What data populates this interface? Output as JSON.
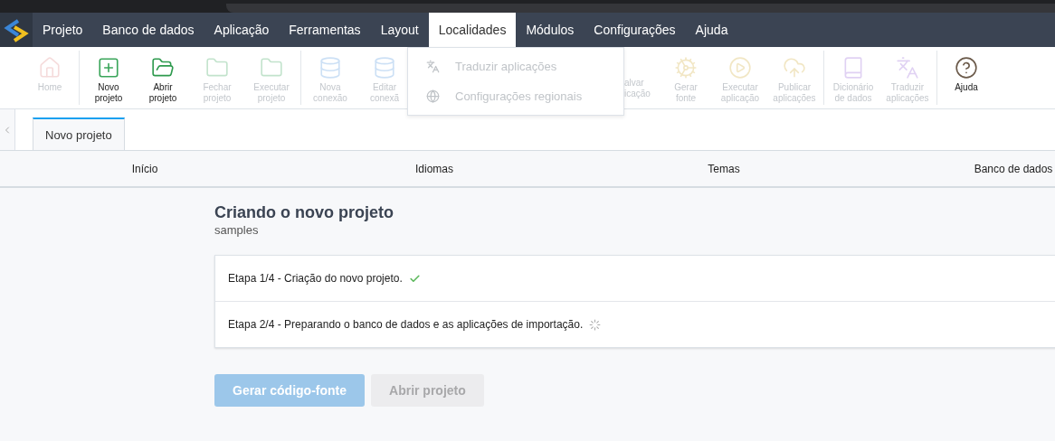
{
  "menu_bar": {
    "items": [
      {
        "label": "Projeto",
        "selected": false
      },
      {
        "label": "Banco de dados",
        "selected": false
      },
      {
        "label": "Aplicação",
        "selected": false
      },
      {
        "label": "Ferramentas",
        "selected": false
      },
      {
        "label": "Layout",
        "selected": false
      },
      {
        "label": "Localidades",
        "selected": true
      },
      {
        "label": "Módulos",
        "selected": false
      },
      {
        "label": "Configurações",
        "selected": false
      },
      {
        "label": "Ajuda",
        "selected": false
      }
    ]
  },
  "toolbar": {
    "groups": [
      [
        {
          "lines": [
            "Home"
          ],
          "disabled": true
        }
      ],
      [
        {
          "lines": [
            "Novo",
            "projeto"
          ],
          "disabled": false
        },
        {
          "lines": [
            "Abrir",
            "projeto"
          ],
          "disabled": false
        },
        {
          "lines": [
            "Fechar",
            "projeto"
          ],
          "disabled": true
        },
        {
          "lines": [
            "Executar",
            "projeto"
          ],
          "disabled": true
        }
      ],
      [
        {
          "lines": [
            "Nova",
            "conexão"
          ],
          "disabled": true
        },
        {
          "lines": [
            "Editar",
            "conexã"
          ],
          "disabled": true
        },
        {
          "kind": "partial",
          "lines": [
            "alvar",
            "icação"
          ],
          "disabled": true
        },
        {
          "lines": [
            "Gerar",
            "fonte"
          ],
          "disabled": true
        },
        {
          "lines": [
            "Executar",
            "aplicação"
          ],
          "disabled": true
        },
        {
          "lines": [
            "Publicar",
            "aplicações"
          ],
          "disabled": true
        }
      ],
      [
        {
          "lines": [
            "Dicionário",
            "de dados"
          ],
          "disabled": true
        },
        {
          "lines": [
            "Traduzir",
            "aplicações"
          ],
          "disabled": true
        }
      ],
      [
        {
          "lines": [
            "Ajuda"
          ],
          "disabled": false
        }
      ]
    ]
  },
  "dropdown": {
    "items": [
      {
        "label": "Traduzir aplicações",
        "disabled": true
      },
      {
        "label": "Configurações regionais",
        "disabled": true
      }
    ]
  },
  "tabs": [
    {
      "label": "Novo projeto",
      "selected": true
    }
  ],
  "wizard_steps": [
    "Início",
    "Idiomas",
    "Temas",
    "Banco de dados"
  ],
  "title": "Criando o novo projeto",
  "subtitle": "samples",
  "progress": [
    {
      "label": "Etapa 1/4 - Criação do novo projeto.",
      "done": true
    },
    {
      "label": "Etapa 2/4 - Preparando o banco de dados e as aplicações de importação.",
      "done": false
    }
  ],
  "buttons": [
    {
      "label": "Gerar código-fonte",
      "kind": "primary",
      "disabled": true
    },
    {
      "label": "Abrir projeto",
      "kind": "secondary",
      "disabled": true
    }
  ]
}
